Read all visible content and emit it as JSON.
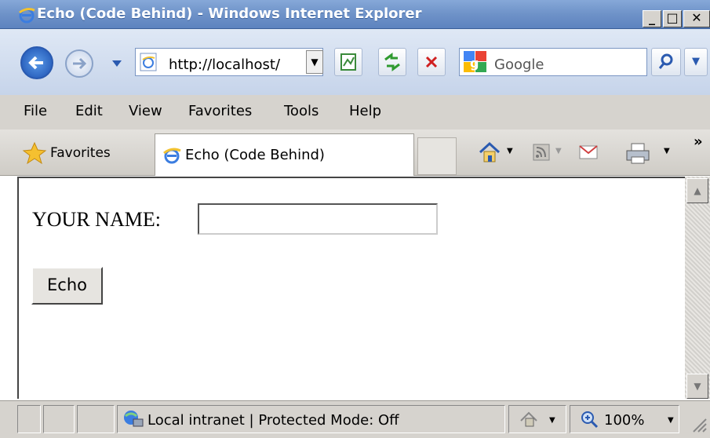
{
  "window": {
    "title": "Echo (Code Behind) - Windows Internet Explorer",
    "minimize": "_",
    "maximize": "□",
    "close": "✕"
  },
  "nav": {
    "address": "http://localhost/",
    "search_placeholder": "Google"
  },
  "menu": {
    "items": [
      "File",
      "Edit",
      "View",
      "Favorites",
      "Tools",
      "Help"
    ]
  },
  "favorites_bar": {
    "favorites_label": "Favorites",
    "tab_title": "Echo (Code Behind)"
  },
  "page": {
    "name_label": "YOUR NAME:",
    "name_value": "",
    "echo_button": "Echo"
  },
  "status": {
    "zone": "Local intranet | Protected Mode: Off",
    "zoom": "100%"
  },
  "colors": {
    "title_bar": "#6e92c8",
    "chrome": "#d6d3ce",
    "link_blue": "#2a5ab0"
  }
}
